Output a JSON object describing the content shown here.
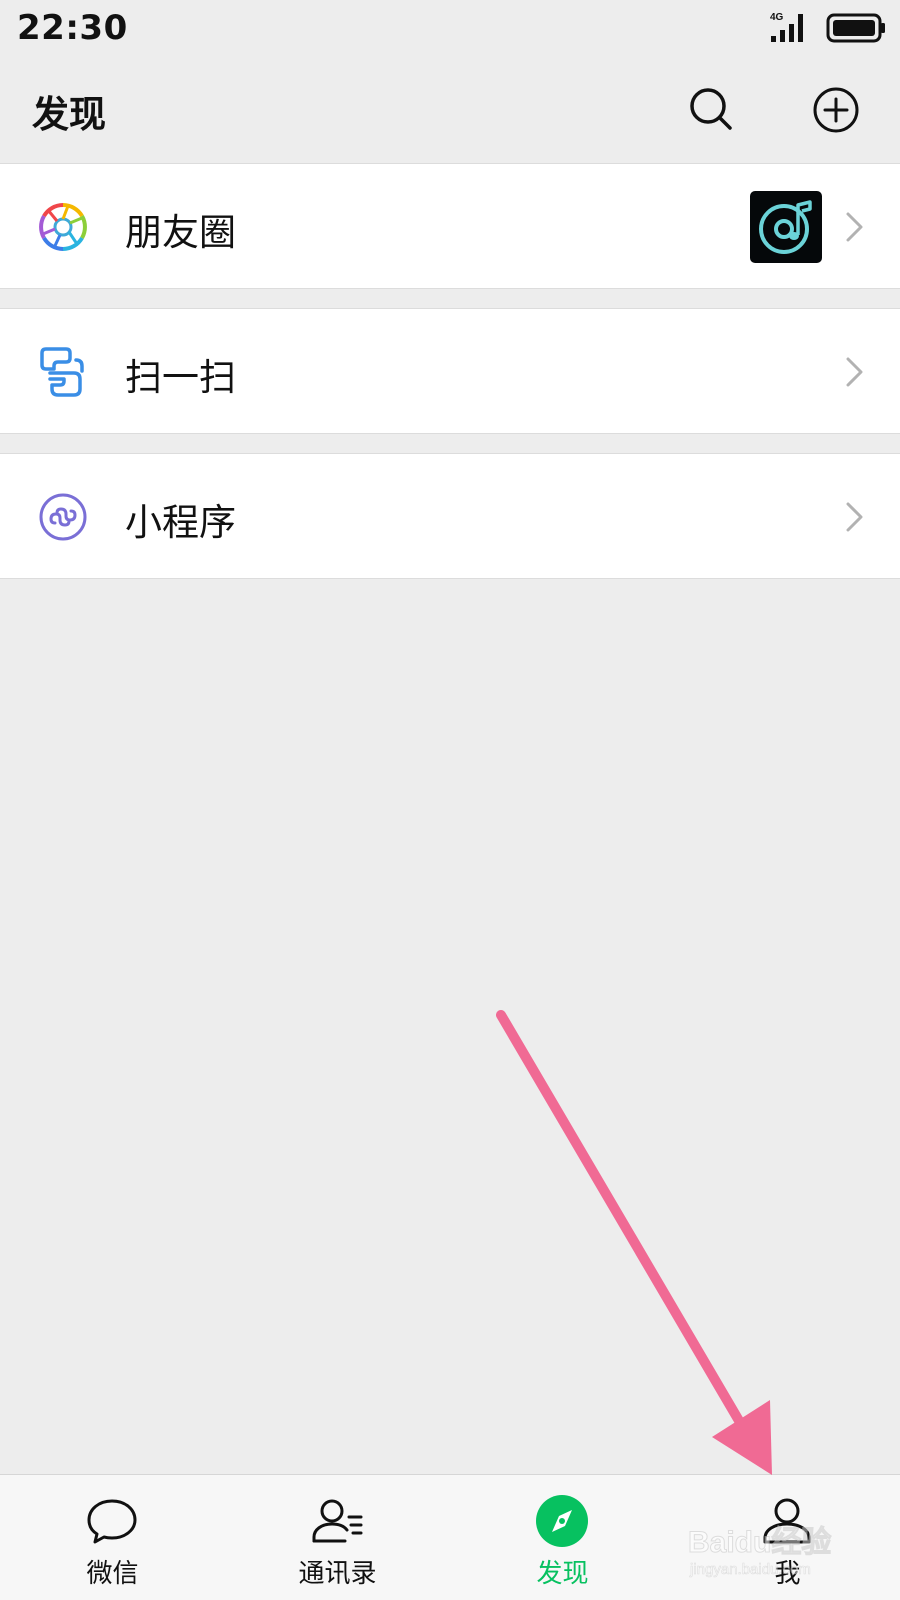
{
  "status_bar": {
    "time": "22:30",
    "network": "4G",
    "signal_icon": "cellular-signal-icon",
    "battery_icon": "battery-icon"
  },
  "header": {
    "title": "发现",
    "search_icon": "search-icon",
    "add_icon": "plus-circle-icon"
  },
  "list": [
    {
      "label": "朋友圈",
      "icon": "moments-icon",
      "has_thumbnail": true,
      "thumbnail_icon": "music-note-icon"
    },
    {
      "label": "扫一扫",
      "icon": "scan-icon"
    },
    {
      "label": "小程序",
      "icon": "mini-program-icon"
    }
  ],
  "tabbar": {
    "tabs": [
      {
        "label": "微信",
        "icon": "chat-bubble-icon",
        "active": false
      },
      {
        "label": "通讯录",
        "icon": "contacts-icon",
        "active": false
      },
      {
        "label": "发现",
        "icon": "compass-icon",
        "active": true
      },
      {
        "label": "我",
        "icon": "person-icon",
        "active": false
      }
    ]
  },
  "colors": {
    "accent": "#07c160",
    "background": "#ededed",
    "annotation_arrow": "#f06a94"
  },
  "watermark": {
    "brand": "Baidu经验",
    "url": "jingyan.baidu.com"
  }
}
